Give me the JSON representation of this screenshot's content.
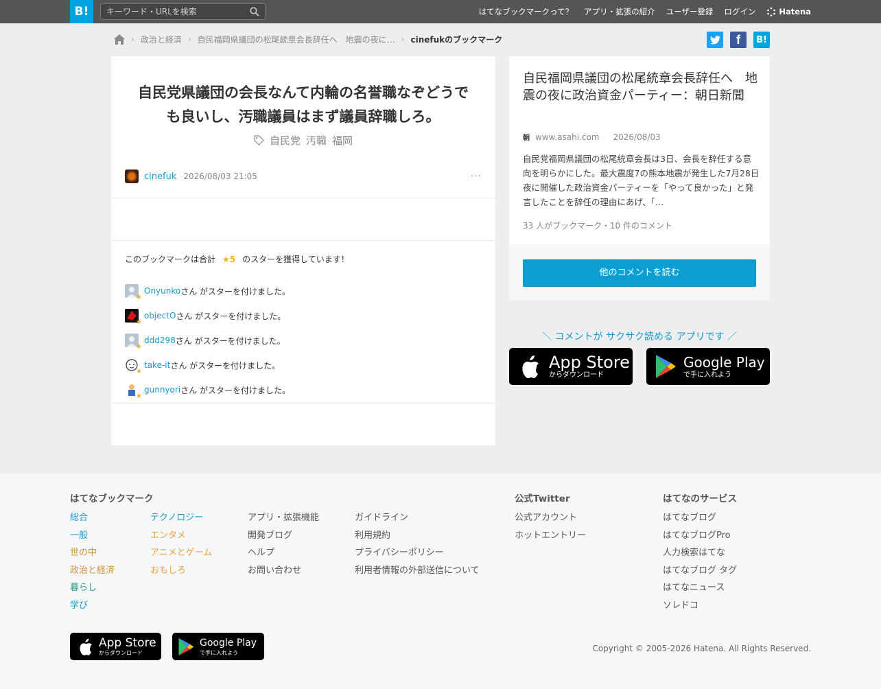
{
  "header": {
    "logo": "B!",
    "search_placeholder": "キーワード・URLを検索",
    "nav": [
      "はてなブックマークって？",
      "アプリ・拡張の紹介",
      "ユーザー登録",
      "ログイン"
    ],
    "brand": "Hatena"
  },
  "breadcrumb": [
    "政治と経済",
    "自民福岡県議団の松尾統章会長辞任へ　地震の夜に…",
    "cinefukのブックマーク"
  ],
  "share": {
    "twitter_color": "#1da1f2",
    "facebook_color": "#3b5998",
    "hatena_color": "#00a4de",
    "hatena_label": "B!"
  },
  "entry": {
    "comment": "自民党県議団の会長なんて内輪の名誉職なぞどうでも良いし、汚職議員はまず議員辞職しろ。",
    "tags": [
      "自民党",
      "汚職",
      "福岡"
    ],
    "user": "cinefuk",
    "datetime": "2026/08/03 21:05",
    "more": "···"
  },
  "stars": {
    "summary_prefix": "このブックマークは合計",
    "summary_total": "★5",
    "summary_suffix": "のスターを獲得しています！",
    "items": [
      {
        "user": "Onyunko",
        "msg": "さん がスターを付けました。"
      },
      {
        "user": "objectO",
        "msg": "さん がスターを付けました。"
      },
      {
        "user": "ddd298",
        "msg": "さん がスターを付けました。"
      },
      {
        "user": "take-it",
        "msg": "さん がスターを付けました。"
      },
      {
        "user": "gunnyori",
        "msg": "さん がスターを付けました。"
      }
    ]
  },
  "source": {
    "title": "自民福岡県議団の松尾統章会長辞任へ　地震の夜に政治資金パーティー：朝日新聞",
    "favicon": "朝",
    "domain": "www.asahi.com",
    "date": "2026/08/03",
    "summary": "自民党福岡県議団の松尾統章会長は3日、会長を辞任する意向を明らかにした。最大震度7の熊本地震が発生した7月28日夜に開催した政治資金パーティーを「やって良かった」と発言したことを辞任の理由にあげ、「…",
    "count": "33 人がブックマーク・10 件のコメント",
    "button": "他のコメントを読む"
  },
  "app_promo": {
    "tagline": "＼ コメントが サクサク読める アプリです ／",
    "appstore_big": "App Store",
    "appstore_small": "からダウンロード",
    "googleplay_big": "Google Play",
    "googleplay_small": "で手に入れよう"
  },
  "footer": {
    "heading_bookmark": "はてなブックマーク",
    "col1": [
      "総合",
      "一般",
      "世の中",
      "政治と経済",
      "暮らし",
      "学び"
    ],
    "col1_colors": [
      "#1a9acb",
      "#1a9acb",
      "#d2933b",
      "#d2933b",
      "#2a9d8f",
      "#1a9acb"
    ],
    "col2": [
      "テクノロジー",
      "エンタメ",
      "アニメとゲーム",
      "おもしろ"
    ],
    "col2_colors": [
      "#1a9acb",
      "#e9a23b",
      "#e9a23b",
      "#e9a23b"
    ],
    "col3": [
      "アプリ・拡張機能",
      "開発ブログ",
      "ヘルプ",
      "お問い合わせ"
    ],
    "col4": [
      "ガイドライン",
      "利用規約",
      "プライバシーポリシー",
      "利用者情報の外部送信について"
    ],
    "heading_twitter": "公式Twitter",
    "col5": [
      "公式アカウント",
      "ホットエントリー"
    ],
    "heading_services": "はてなのサービス",
    "col6": [
      "はてなブログ",
      "はてなブログPro",
      "人力検索はてな",
      "はてなブログ タグ",
      "はてなニュース",
      "ソレドコ"
    ],
    "copyright": "Copyright © 2005-2026 Hatena. All Rights Reserved."
  }
}
